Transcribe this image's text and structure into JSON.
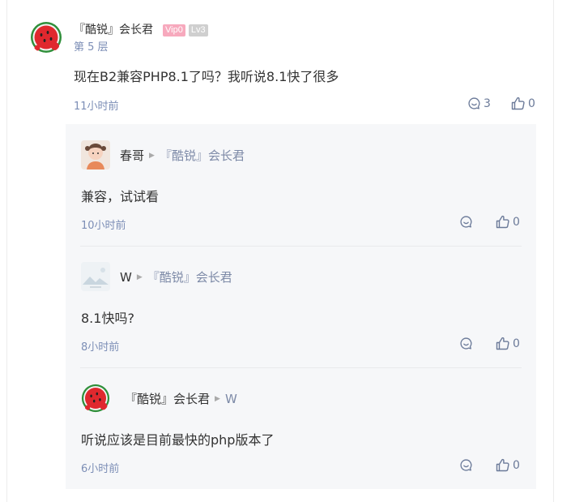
{
  "main_comment": {
    "author": "『酷锐』会长君",
    "badges": {
      "vip": "Vip0",
      "level": "Lv3"
    },
    "floor": "第 5 层",
    "text": "现在B2兼容PHP8.1了吗？我听说8.1快了很多",
    "time": "11小时前",
    "reply_count": "3",
    "like_count": "0"
  },
  "replies": [
    {
      "from": "春哥",
      "to": "『酷锐』会长君",
      "text": "兼容，试试看",
      "time": "10小时前",
      "like_count": "0",
      "avatar": "girl-photo"
    },
    {
      "from": "W",
      "to": "『酷锐』会长君",
      "text": "8.1快吗?",
      "time": "8小时前",
      "like_count": "0",
      "avatar": "placeholder-image"
    },
    {
      "from": "『酷锐』会长君",
      "to": "W",
      "text": "听说应该是目前最快的php版本了",
      "time": "6小时前",
      "like_count": "0",
      "avatar": "watermelon"
    }
  ],
  "colors": {
    "link_blue": "#7c8eb6",
    "vip_pink": "#f7a9bd",
    "level_gray": "#cfcfcf",
    "reply_bg": "#f6f7f9"
  }
}
